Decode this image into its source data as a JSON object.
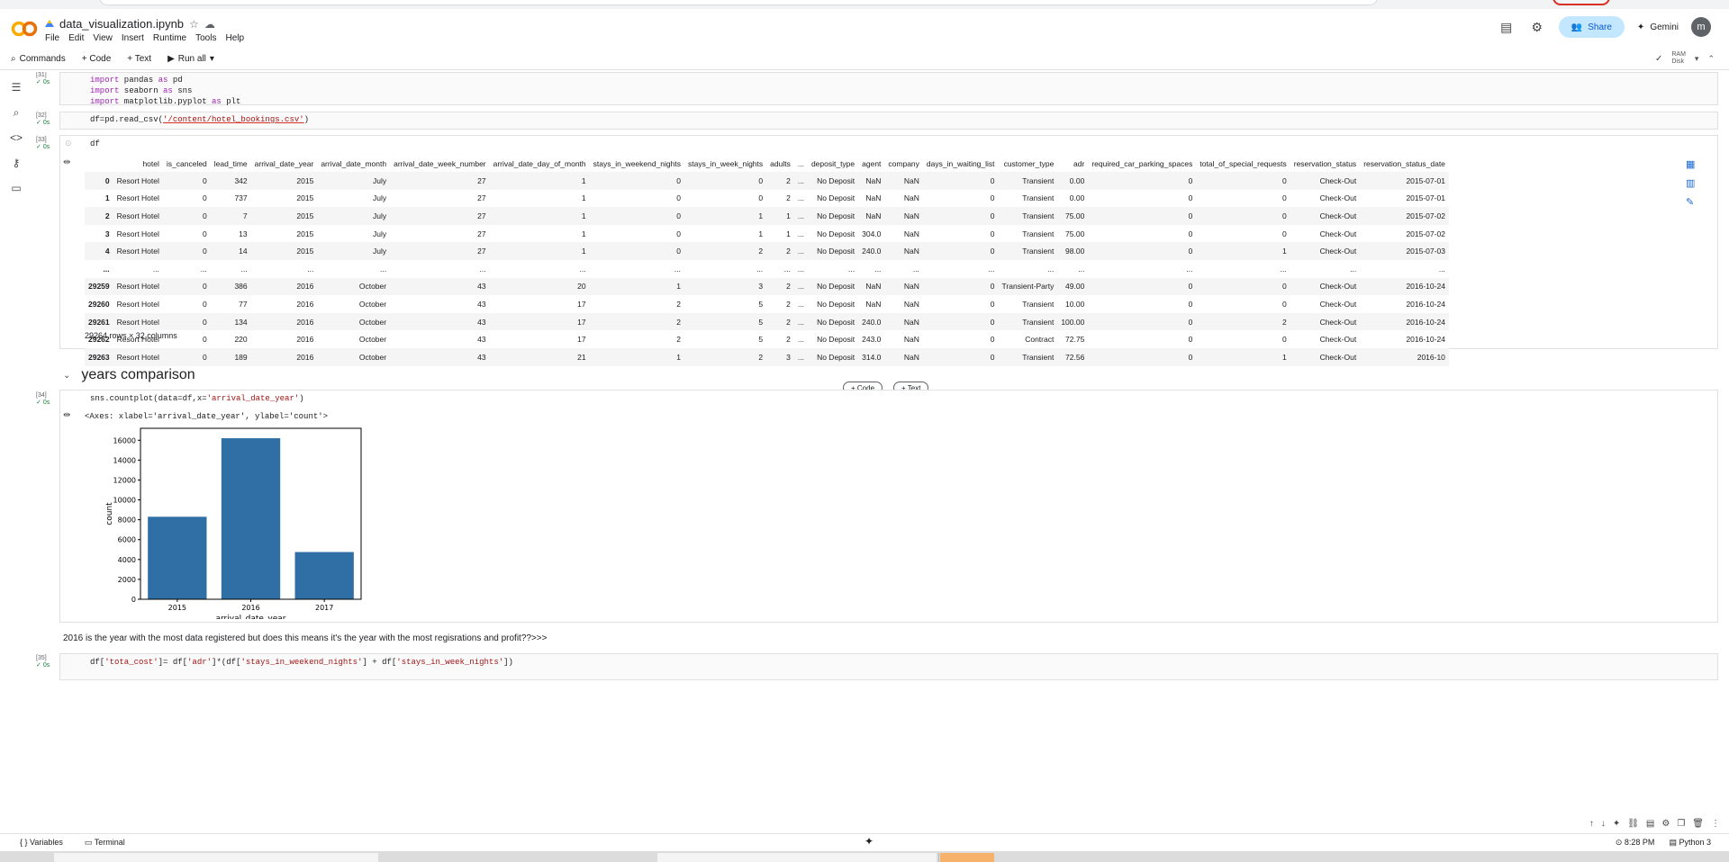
{
  "header": {
    "file_name": "data_visualization.ipynb",
    "menu": [
      "File",
      "Edit",
      "View",
      "Insert",
      "Runtime",
      "Tools",
      "Help"
    ],
    "share_label": "Share",
    "gemini_label": "Gemini",
    "avatar_letter": "m"
  },
  "toolbar": {
    "commands": "Commands",
    "code": "+ Code",
    "text": "+ Text",
    "run_all": "Run all",
    "ram": "RAM",
    "disk": "Disk"
  },
  "cells": {
    "c31": {
      "num": "[31]",
      "time": "0s"
    },
    "c32": {
      "num": "[32]",
      "time": "0s"
    },
    "c33": {
      "num": "[33]",
      "time": "0s",
      "code": "df"
    },
    "c34": {
      "num": "[34]",
      "time": "0s"
    },
    "c35": {
      "num": "[35]",
      "time": "0s"
    }
  },
  "code31": {
    "l1a": "import",
    "l1b": " pandas ",
    "l1c": "as",
    "l1d": " pd",
    "l2a": "import",
    "l2b": " seaborn ",
    "l2c": "as",
    "l2d": " sns",
    "l3a": "import",
    "l3b": " matplotlib.pyplot ",
    "l3c": "as",
    "l3d": " plt"
  },
  "code32": {
    "a": "df=pd.read_csv(",
    "b": "'/content/hotel_bookings.csv'",
    "c": ")"
  },
  "code34": {
    "a": "sns.countplot(data=df,x=",
    "b": "'arrival_date_year'",
    "c": ")"
  },
  "code35": {
    "a": "df[",
    "b": "'tota_cost'",
    "c": "]= df[",
    "d": "'adr'",
    "e": "]*(df[",
    "f": "'stays_in_weekend_nights'",
    "g": "] + df[",
    "h": "'stays_in_week_nights'",
    "i": "])"
  },
  "dataframe": {
    "columns": [
      "",
      "hotel",
      "is_canceled",
      "lead_time",
      "arrival_date_year",
      "arrival_date_month",
      "arrival_date_week_number",
      "arrival_date_day_of_month",
      "stays_in_weekend_nights",
      "stays_in_week_nights",
      "adults",
      "...",
      "deposit_type",
      "agent",
      "company",
      "days_in_waiting_list",
      "customer_type",
      "adr",
      "required_car_parking_spaces",
      "total_of_special_requests",
      "reservation_status",
      "reservation_status_date"
    ],
    "rows": [
      [
        "0",
        "Resort Hotel",
        "0",
        "342",
        "2015",
        "July",
        "27",
        "1",
        "0",
        "0",
        "2",
        "...",
        "No Deposit",
        "NaN",
        "NaN",
        "0",
        "Transient",
        "0.00",
        "0",
        "0",
        "Check-Out",
        "2015-07-01"
      ],
      [
        "1",
        "Resort Hotel",
        "0",
        "737",
        "2015",
        "July",
        "27",
        "1",
        "0",
        "0",
        "2",
        "...",
        "No Deposit",
        "NaN",
        "NaN",
        "0",
        "Transient",
        "0.00",
        "0",
        "0",
        "Check-Out",
        "2015-07-01"
      ],
      [
        "2",
        "Resort Hotel",
        "0",
        "7",
        "2015",
        "July",
        "27",
        "1",
        "0",
        "1",
        "1",
        "...",
        "No Deposit",
        "NaN",
        "NaN",
        "0",
        "Transient",
        "75.00",
        "0",
        "0",
        "Check-Out",
        "2015-07-02"
      ],
      [
        "3",
        "Resort Hotel",
        "0",
        "13",
        "2015",
        "July",
        "27",
        "1",
        "0",
        "1",
        "1",
        "...",
        "No Deposit",
        "304.0",
        "NaN",
        "0",
        "Transient",
        "75.00",
        "0",
        "0",
        "Check-Out",
        "2015-07-02"
      ],
      [
        "4",
        "Resort Hotel",
        "0",
        "14",
        "2015",
        "July",
        "27",
        "1",
        "0",
        "2",
        "2",
        "...",
        "No Deposit",
        "240.0",
        "NaN",
        "0",
        "Transient",
        "98.00",
        "0",
        "1",
        "Check-Out",
        "2015-07-03"
      ],
      [
        "...",
        "...",
        "...",
        "...",
        "...",
        "...",
        "...",
        "...",
        "...",
        "...",
        "...",
        "...",
        "...",
        "...",
        "...",
        "...",
        "...",
        "...",
        "...",
        "...",
        "...",
        "..."
      ],
      [
        "29259",
        "Resort Hotel",
        "0",
        "386",
        "2016",
        "October",
        "43",
        "20",
        "1",
        "3",
        "2",
        "...",
        "No Deposit",
        "NaN",
        "NaN",
        "0",
        "Transient-Party",
        "49.00",
        "0",
        "0",
        "Check-Out",
        "2016-10-24"
      ],
      [
        "29260",
        "Resort Hotel",
        "0",
        "77",
        "2016",
        "October",
        "43",
        "17",
        "2",
        "5",
        "2",
        "...",
        "No Deposit",
        "NaN",
        "NaN",
        "0",
        "Transient",
        "10.00",
        "0",
        "0",
        "Check-Out",
        "2016-10-24"
      ],
      [
        "29261",
        "Resort Hotel",
        "0",
        "134",
        "2016",
        "October",
        "43",
        "17",
        "2",
        "5",
        "2",
        "...",
        "No Deposit",
        "240.0",
        "NaN",
        "0",
        "Transient",
        "100.00",
        "0",
        "2",
        "Check-Out",
        "2016-10-24"
      ],
      [
        "29262",
        "Resort Hotel",
        "0",
        "220",
        "2016",
        "October",
        "43",
        "17",
        "2",
        "5",
        "2",
        "...",
        "No Deposit",
        "243.0",
        "NaN",
        "0",
        "Contract",
        "72.75",
        "0",
        "0",
        "Check-Out",
        "2016-10-24"
      ],
      [
        "29263",
        "Resort Hotel",
        "0",
        "189",
        "2016",
        "October",
        "43",
        "21",
        "1",
        "2",
        "3",
        "...",
        "No Deposit",
        "314.0",
        "NaN",
        "0",
        "Transient",
        "72.56",
        "0",
        "1",
        "Check-Out",
        "2016-10"
      ]
    ],
    "shape": "29264 rows × 32 columns"
  },
  "section": {
    "title": "years comparison"
  },
  "add_buttons": {
    "code": "+ Code",
    "text": "+ Text"
  },
  "axes_output": "<Axes: xlabel='arrival_date_year', ylabel='count'>",
  "chart_data": {
    "type": "bar",
    "categories": [
      "2015",
      "2016",
      "2017"
    ],
    "values": [
      8300,
      16200,
      4750
    ],
    "title": "",
    "xlabel": "arrival_date_year",
    "ylabel": "count",
    "ylim": [
      0,
      17200
    ],
    "yticks": [
      0,
      2000,
      4000,
      6000,
      8000,
      10000,
      12000,
      14000,
      16000
    ],
    "color": "#2f6fa5"
  },
  "markdown_text": "2016 is the year with the most data registered but does this means it's the year with the most regisrations and profit??>>>",
  "statusbar": {
    "variables": "Variables",
    "terminal": "Terminal",
    "time": "8:28 PM",
    "kernel": "Python 3"
  }
}
